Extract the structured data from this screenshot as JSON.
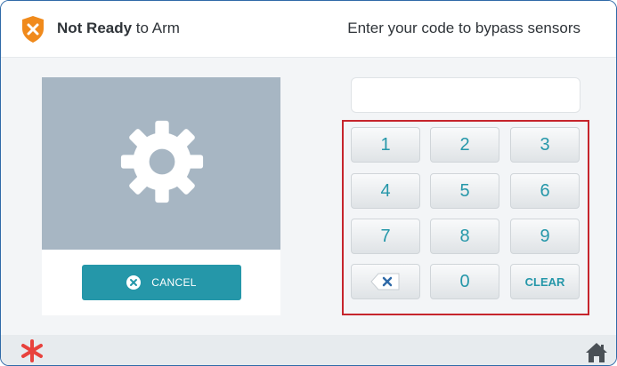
{
  "header": {
    "status_strong": "Not Ready",
    "status_rest": " to Arm",
    "instruction": "Enter your code to bypass sensors"
  },
  "left_panel": {
    "cancel_label": "CANCEL"
  },
  "code_display": {
    "value": ""
  },
  "keypad": {
    "keys": [
      "1",
      "2",
      "3",
      "4",
      "5",
      "6",
      "7",
      "8",
      "9",
      "",
      "0",
      "CLEAR"
    ]
  },
  "icons": {
    "status": "shield-x-icon",
    "camera": "gear-icon",
    "backspace": "backspace-icon",
    "cancel": "close-circle-icon",
    "footer_left": "asterisk-icon",
    "footer_right": "home-icon"
  },
  "colors": {
    "accent": "#2597a9",
    "warning": "#f08a1c",
    "keypad_highlight": "#c6252c",
    "asterisk": "#e8423d"
  }
}
